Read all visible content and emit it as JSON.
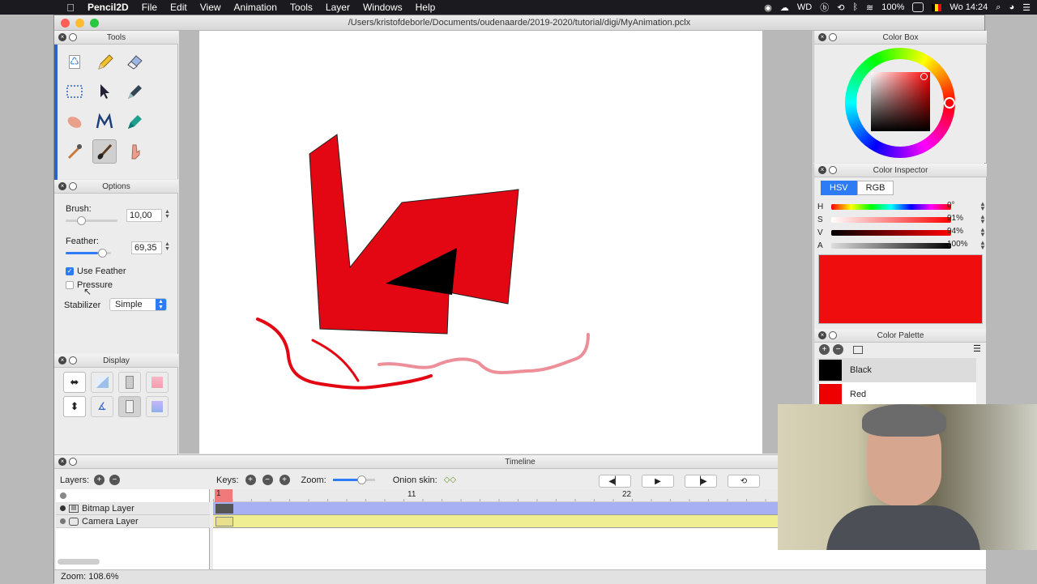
{
  "menubar": {
    "app": "Pencil2D",
    "items": [
      "File",
      "Edit",
      "View",
      "Animation",
      "Tools",
      "Layer",
      "Windows",
      "Help"
    ],
    "battery": "100%",
    "clock": "Wo 14:24"
  },
  "window": {
    "title": "/Users/kristofdeborle/Documents/oudenaarde/2019-2020/tutorial/digi/MyAnimation.pclx"
  },
  "tools_panel": {
    "title": "Tools"
  },
  "options_panel": {
    "title": "Options",
    "brush_label": "Brush:",
    "brush_value": "10,00",
    "feather_label": "Feather:",
    "feather_value": "69,35",
    "use_feather_label": "Use Feather",
    "use_feather_checked": true,
    "pressure_label": "Pressure",
    "pressure_checked": false,
    "stabilizer_label": "Stabilizer",
    "stabilizer_value": "Simple"
  },
  "display_panel": {
    "title": "Display"
  },
  "color_box": {
    "title": "Color Box"
  },
  "color_inspector": {
    "title": "Color Inspector",
    "tabs": [
      "HSV",
      "RGB"
    ],
    "active_tab": "HSV",
    "channels": [
      {
        "label": "H",
        "value": "0°"
      },
      {
        "label": "S",
        "value": "91%"
      },
      {
        "label": "V",
        "value": "94%"
      },
      {
        "label": "A",
        "value": "100%"
      }
    ],
    "current_color": "#ef0d0d"
  },
  "color_palette": {
    "title": "Color Palette",
    "swatches": [
      {
        "name": "Black",
        "color": "#000000"
      },
      {
        "name": "Red",
        "color": "#ee0000"
      }
    ]
  },
  "timeline": {
    "title": "Timeline",
    "layers_label": "Layers:",
    "keys_label": "Keys:",
    "zoom_label": "Zoom:",
    "onion_label": "Onion skin:",
    "frame_numbers": [
      "1",
      "11",
      "22"
    ],
    "layers": [
      {
        "name": "Bitmap Layer",
        "color": "#a7b0f2"
      },
      {
        "name": "Camera Layer",
        "color": "#f0ee92"
      }
    ]
  },
  "statusbar": {
    "zoom": "Zoom: 108.6%"
  }
}
